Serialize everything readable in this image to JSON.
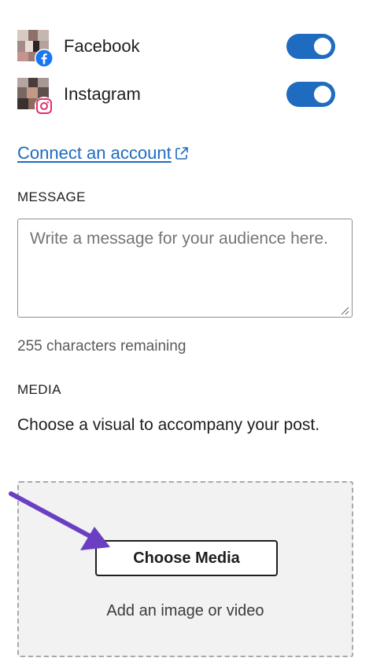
{
  "accounts": [
    {
      "name": "Facebook",
      "network": "facebook",
      "enabled": true,
      "badge_icon": "facebook-icon"
    },
    {
      "name": "Instagram",
      "network": "instagram",
      "enabled": true,
      "badge_icon": "instagram-icon"
    }
  ],
  "connect_link": {
    "label": "Connect an account",
    "icon": "external-link-icon"
  },
  "message": {
    "label": "MESSAGE",
    "placeholder": "Write a message for your audience here.",
    "value": "",
    "chars_remaining": "255 characters remaining"
  },
  "media": {
    "label": "MEDIA",
    "description": "Choose a visual to accompany your post.",
    "button_label": "Choose Media",
    "hint": "Add an image or video"
  },
  "colors": {
    "toggle_on": "#1e6bbf",
    "link": "#1e6bbf",
    "facebook": "#1877f2",
    "instagram": "#e1306c",
    "annotation_arrow": "#6b3fc2"
  }
}
